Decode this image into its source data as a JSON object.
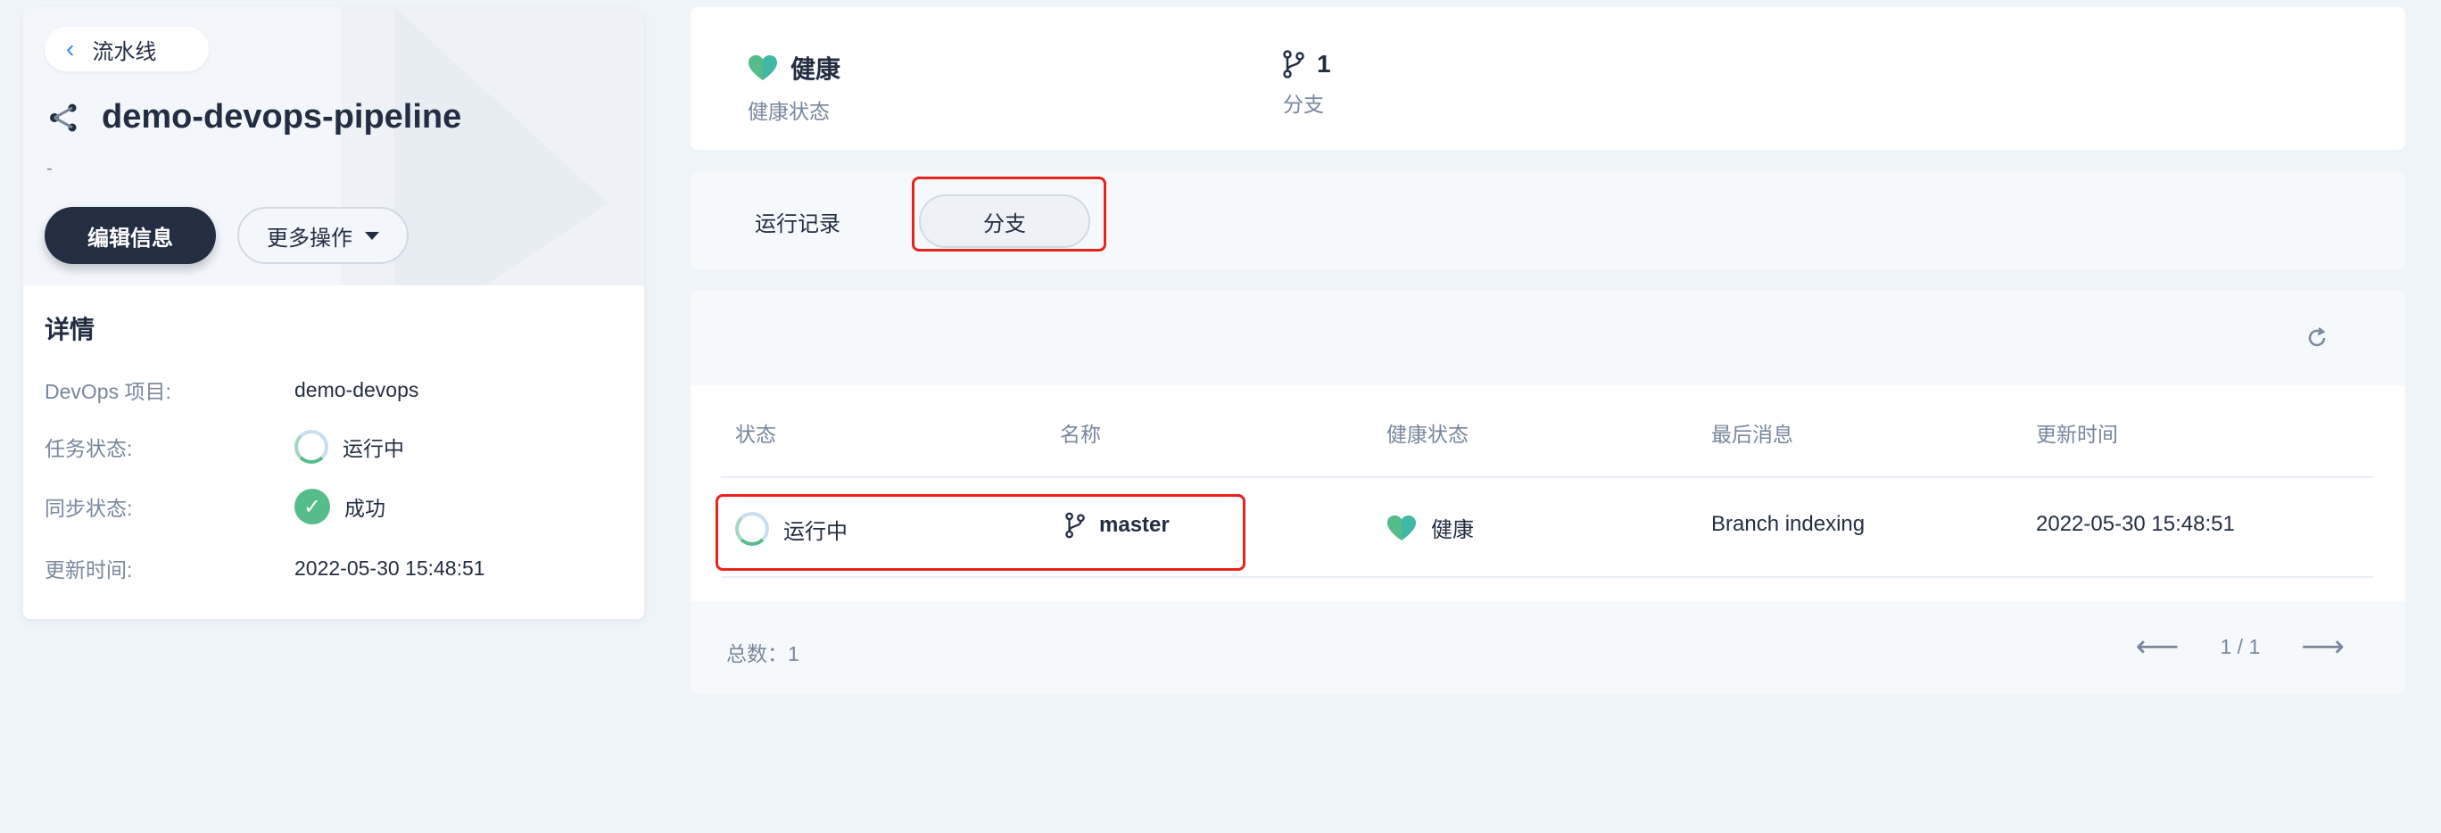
{
  "left": {
    "back_label": "流水线",
    "pipeline_name": "demo-devops-pipeline",
    "description": "-",
    "edit_button": "编辑信息",
    "more_button": "更多操作",
    "details_title": "详情",
    "details": [
      {
        "key": "DevOps 项目:",
        "value": "demo-devops",
        "icon": ""
      },
      {
        "key": "任务状态:",
        "value": "运行中",
        "icon": "running-spinner-icon"
      },
      {
        "key": "同步状态:",
        "value": "成功",
        "icon": "success-check-icon"
      },
      {
        "key": "更新时间:",
        "value": "2022-05-30 15:48:51",
        "icon": ""
      }
    ]
  },
  "stats": {
    "health_value": "健康",
    "health_label": "健康状态",
    "branch_value": "1",
    "branch_label": "分支"
  },
  "tabs": {
    "runs": "运行记录",
    "branches": "分支"
  },
  "table": {
    "headers": [
      "状态",
      "名称",
      "健康状态",
      "最后消息",
      "更新时间"
    ],
    "rows": [
      {
        "status": "运行中",
        "name": "master",
        "health": "健康",
        "message": "Branch indexing",
        "updated": "2022-05-30 15:48:51"
      }
    ],
    "total": "总数：1",
    "page": "1 / 1"
  },
  "colors": {
    "dark": "#242e42",
    "muted": "#79879c",
    "healthy": "#55bc8a",
    "highlight": "#e8231b"
  }
}
